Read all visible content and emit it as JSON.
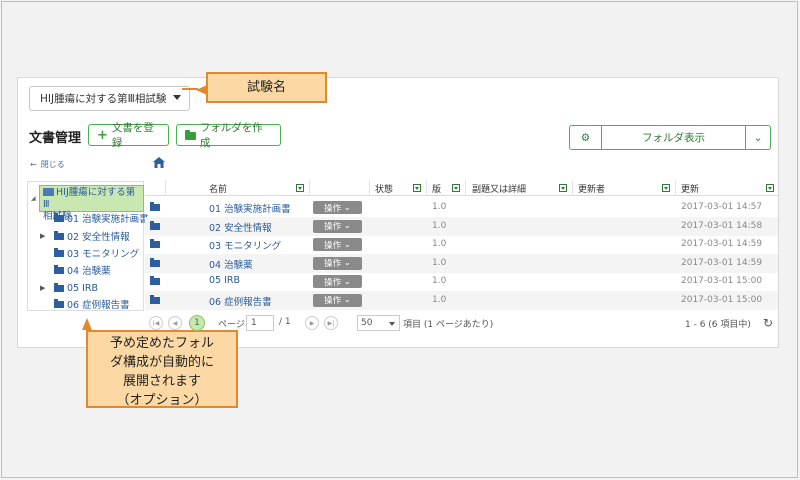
{
  "study_selector": {
    "value": "HIJ腫瘍に対する第Ⅲ相試験"
  },
  "callouts": {
    "study_name": "試験名",
    "folder_note": [
      "予め定めたフォル",
      "ダ構成が自動的に",
      "展開されます",
      "（オプション）"
    ]
  },
  "toolbar": {
    "title": "文書管理",
    "register_button": "文書を登録",
    "create_folder_button": "フォルダを作成",
    "view_button": "フォルダ表示"
  },
  "close_link": "閉じる",
  "tree": {
    "root_line1": "HIJ腫瘍に対する第Ⅲ",
    "root_line2": "相試験",
    "items": [
      {
        "label": "01 治験実施計画書",
        "expandable": false
      },
      {
        "label": "02 安全性情報",
        "expandable": true
      },
      {
        "label": "03 モニタリング",
        "expandable": false
      },
      {
        "label": "04 治験薬",
        "expandable": false
      },
      {
        "label": "05 IRB",
        "expandable": true
      },
      {
        "label": "06 症例報告書",
        "expandable": false
      }
    ]
  },
  "grid": {
    "headers": {
      "name": "名前",
      "status": "状態",
      "version": "版",
      "subtitle": "副題又は詳細",
      "updater": "更新者",
      "updated": "更新"
    },
    "rows": [
      {
        "name": "01 治験実施計画書",
        "op": "操作",
        "version": "1.0",
        "updated": "2017-03-01 14:57"
      },
      {
        "name": "02 安全性情報",
        "op": "操作",
        "version": "1.0",
        "updated": "2017-03-01 14:58"
      },
      {
        "name": "03 モニタリング",
        "op": "操作",
        "version": "1.0",
        "updated": "2017-03-01 14:59"
      },
      {
        "name": "04 治験薬",
        "op": "操作",
        "version": "1.0",
        "updated": "2017-03-01 14:59"
      },
      {
        "name": "05 IRB",
        "op": "操作",
        "version": "1.0",
        "updated": "2017-03-01 15:00"
      },
      {
        "name": "06 症例報告書",
        "op": "操作",
        "version": "1.0",
        "updated": "2017-03-01 15:00"
      }
    ]
  },
  "pager": {
    "current_page": "1",
    "page_label": "ページ",
    "page_input": "1",
    "total_pages": "/ 1",
    "per_page": "50",
    "per_page_label": "項目 (1 ページあたり)",
    "summary": "1 - 6 (6 項目中)"
  },
  "colors": {
    "accent_green": "#4caf50",
    "callout_fill": "#fcd9a4",
    "callout_border": "#e08a2f",
    "link_blue": "#2a5b9b"
  }
}
